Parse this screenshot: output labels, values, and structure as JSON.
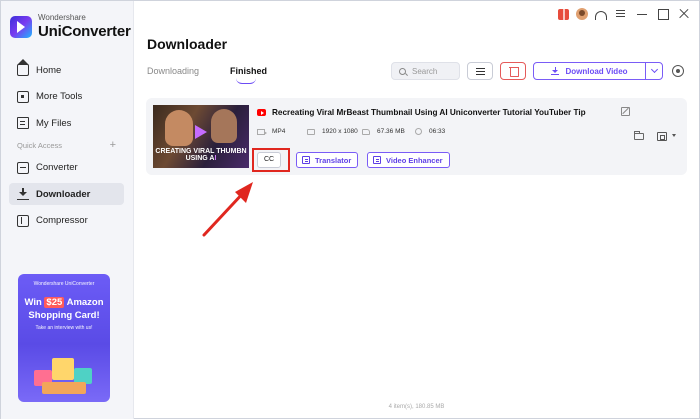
{
  "app": {
    "company": "Wondershare",
    "product": "UniConverter"
  },
  "sidebar": {
    "items": [
      {
        "label": "Home",
        "icon": "home-icon"
      },
      {
        "label": "More Tools",
        "icon": "tools-icon"
      },
      {
        "label": "My Files",
        "icon": "files-icon"
      }
    ],
    "quick_access_label": "Quick Access",
    "quick_items": [
      {
        "label": "Converter",
        "icon": "converter-icon"
      },
      {
        "label": "Downloader",
        "icon": "downloader-icon",
        "active": true
      },
      {
        "label": "Compressor",
        "icon": "compressor-icon"
      }
    ]
  },
  "promo": {
    "brand": "Wondershare UniConverter",
    "line1_prefix": "Win",
    "amount": "$25",
    "line1_suffix": "Amazon",
    "line2": "Shopping Card!",
    "sub": "Take an interview with us!"
  },
  "header": {
    "title": "Downloader",
    "tabs": [
      {
        "label": "Downloading",
        "active": false
      },
      {
        "label": "Finished",
        "active": true
      }
    ],
    "search_placeholder": "Search",
    "download_video_label": "Download Video"
  },
  "video": {
    "title": "Recreating Viral MrBeast Thumbnail Using AI  Uniconverter Tutorial  YouTuber Tip",
    "format": "MP4",
    "resolution": "1920 x 1080",
    "size": "67.36 MB",
    "duration": "06:33",
    "thumbnail_text_line1": "CREATING VIRAL THUMBN",
    "thumbnail_text_line2_a": "USING A",
    "thumbnail_text_line2_b": "I",
    "cc_label": "CC",
    "translator_label": "Translator",
    "enhancer_label": "Video Enhancer"
  },
  "footer": {
    "summary": "4 item(s), 180.85 MB"
  },
  "colors": {
    "accent": "#6c4cf5",
    "danger": "#e55a5a",
    "annotation": "#e0271f"
  }
}
